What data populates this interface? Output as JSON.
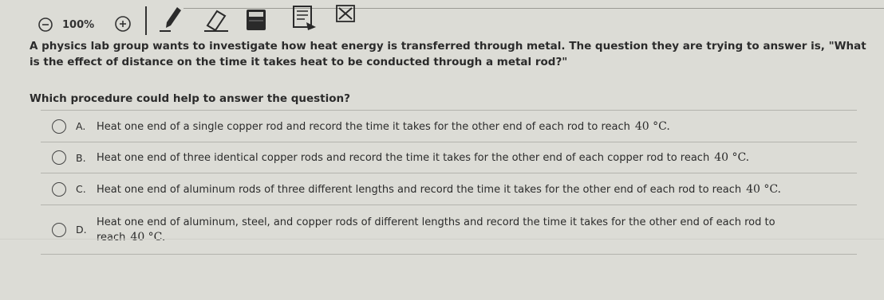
{
  "toolbar": {
    "zoom_level": "100%",
    "icons": [
      "zoom-out-icon",
      "zoom-in-icon",
      "pen-icon",
      "eraser-icon",
      "calculator-icon",
      "reference-sheet-icon",
      "close-icon"
    ]
  },
  "question": {
    "text": "A physics lab group wants to investigate how heat energy is transferred through metal. The question they are trying to answer is, \"What is the effect of distance on the time it takes heat to be conducted through a metal rod?\"",
    "prompt": "Which procedure could help to answer the question?"
  },
  "choices": [
    {
      "letter": "A.",
      "text": "Heat one end of a single copper rod and record the time it takes for the other end of each rod to reach",
      "value": "40 °C."
    },
    {
      "letter": "B.",
      "text": "Heat one end of three identical copper rods and record the time it takes for the other end of each copper rod to reach",
      "value": "40 °C."
    },
    {
      "letter": "C.",
      "text": "Heat one end of aluminum rods of three different lengths and record the time it takes for the other end of each rod to reach",
      "value": "40 °C."
    },
    {
      "letter": "D.",
      "text": "Heat one end of aluminum, steel, and copper rods of different lengths and record the time it takes for the other end of each rod to",
      "text2": "reach",
      "value": "40 °C."
    }
  ]
}
